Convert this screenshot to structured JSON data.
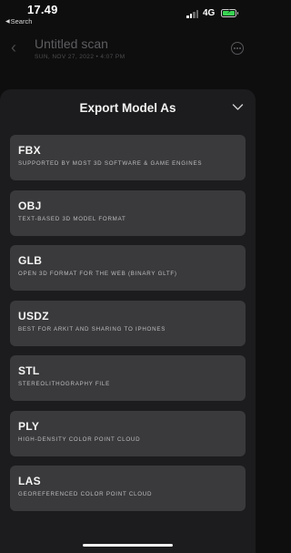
{
  "status_bar": {
    "time": "17.49",
    "back_label": "Search",
    "network": "4G",
    "battery_level": 1.0,
    "battery_color": "#39d353"
  },
  "header": {
    "title": "Untitled scan",
    "subtitle": "SUN, NOV 27, 2022 • 4:07 PM",
    "back_icon": "chevron-left-icon",
    "more_icon": "more-icon"
  },
  "sheet": {
    "title": "Export Model As",
    "collapse_icon": "chevron-down-icon",
    "options": [
      {
        "name": "FBX",
        "description": "Supported by most 3D software & game engines"
      },
      {
        "name": "OBJ",
        "description": "Text-based 3D model format"
      },
      {
        "name": "GLB",
        "description": "Open 3D format for the web (binary glTF)"
      },
      {
        "name": "USDZ",
        "description": "Best for ARKit and sharing to iPhones"
      },
      {
        "name": "STL",
        "description": "Stereolithography file"
      },
      {
        "name": "PLY",
        "description": "High-density color point cloud"
      },
      {
        "name": "LAS",
        "description": "Georeferenced color point cloud"
      }
    ]
  },
  "colors": {
    "background": "#0e0e0f",
    "sheet": "#1c1c1e",
    "option_card": "#3a3a3c"
  }
}
